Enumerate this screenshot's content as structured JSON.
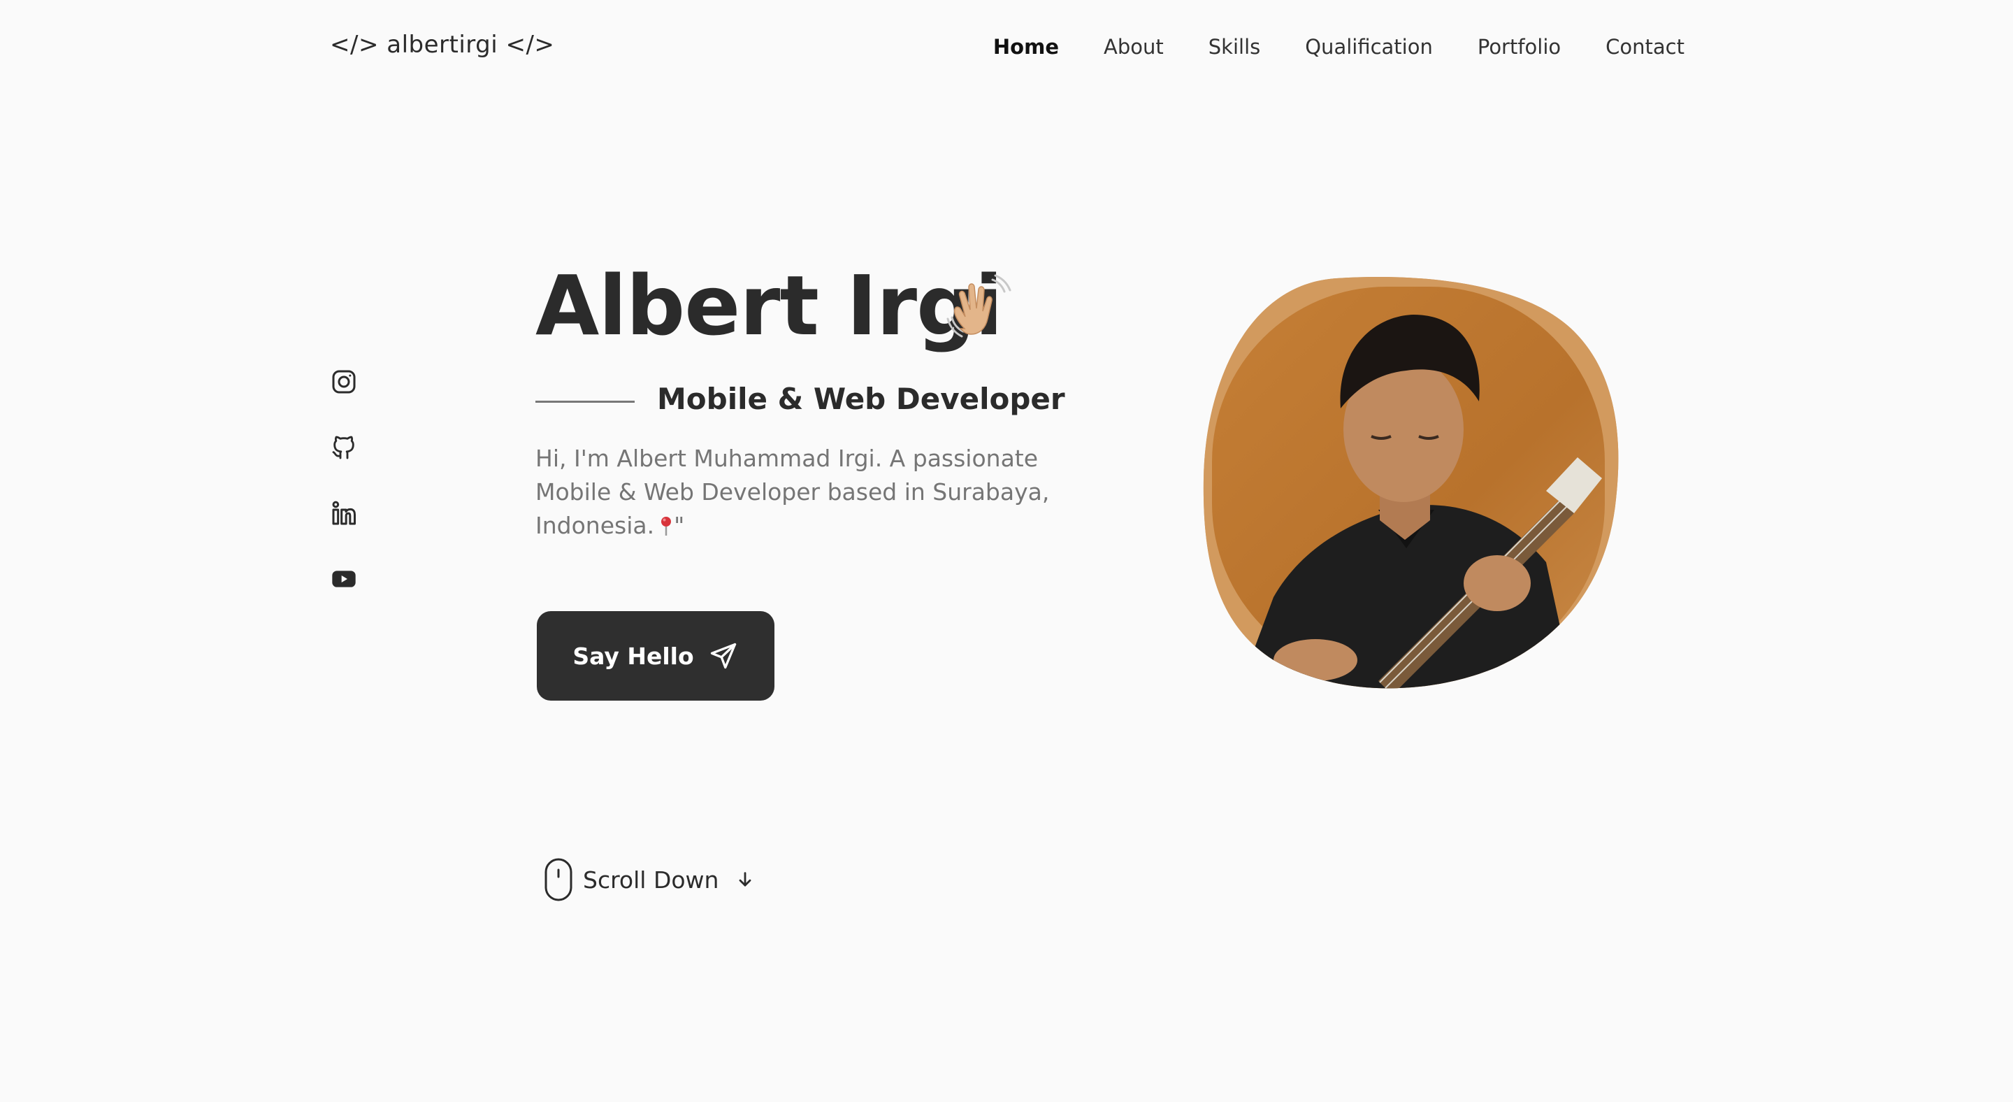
{
  "header": {
    "logo": "</> albertirgi </>",
    "nav": [
      {
        "label": "Home",
        "active": true
      },
      {
        "label": "About"
      },
      {
        "label": "Skills"
      },
      {
        "label": "Qualification"
      },
      {
        "label": "Portfolio"
      },
      {
        "label": "Contact"
      }
    ]
  },
  "social": [
    "instagram-icon",
    "github-icon",
    "linkedin-icon",
    "youtube-icon"
  ],
  "hero": {
    "title": "Albert Irgi",
    "subtitle": "Mobile & Web Developer",
    "description": "Hi, I'm Albert Muhammad Irgi. A passionate Mobile & Web Developer based in Surabaya, Indonesia.",
    "description_suffix": "\"",
    "cta_label": "Say Hello",
    "scroll_label": "Scroll Down"
  },
  "colors": {
    "background": "#fafafa",
    "text": "#333333",
    "button": "#2f2f2f",
    "blob_border": "#d29a5e"
  }
}
